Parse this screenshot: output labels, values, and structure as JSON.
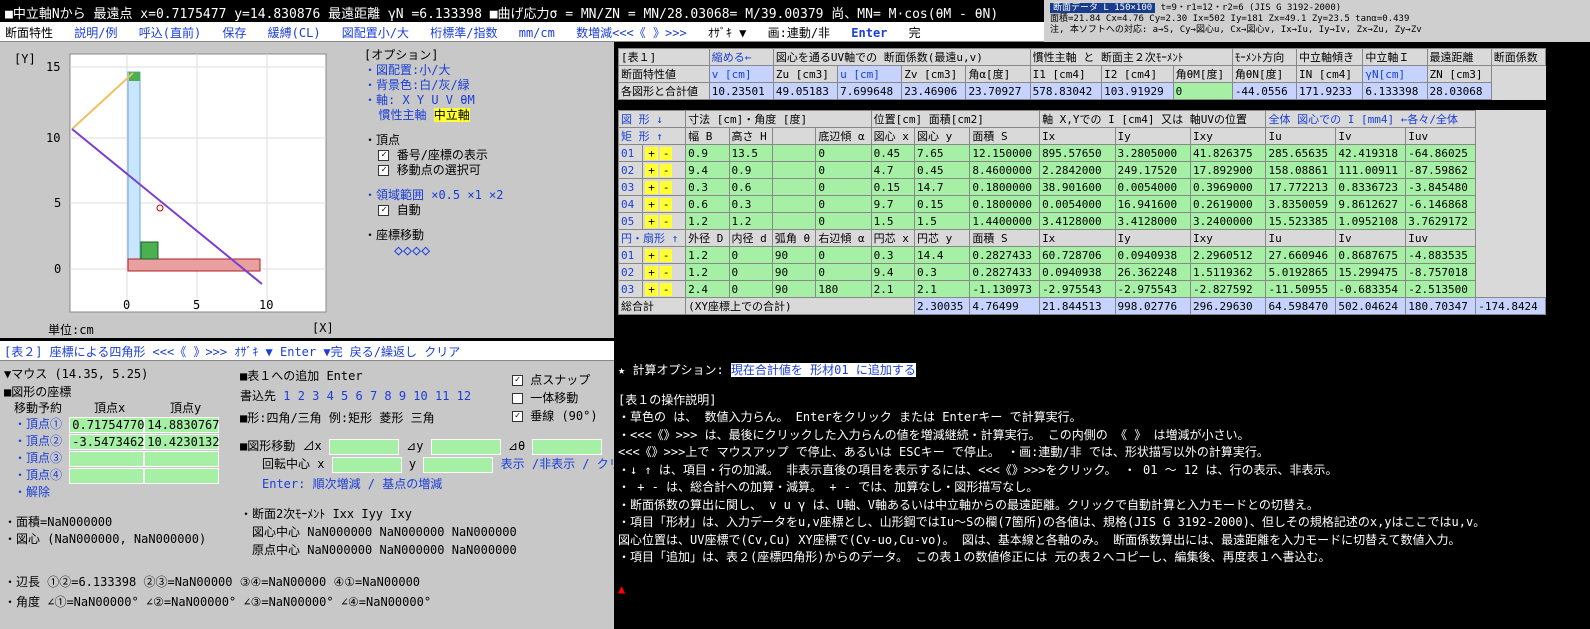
{
  "topbar": {
    "text": "■中立軸Nから 最遠点 x=0.7175477 y=14.830876 最遠距離 γN =6.133398 ■曲げ応力σ = MN/ZN = MN/28.03068= M/39.00379 尚、MN= M·cos(θM - θN)"
  },
  "info": {
    "tag": "断面データ L 150×100",
    "l1": "t=9・r1=12・r2=6 (JIS G 3192-2000)",
    "l2": "面積=21.84 Cx=4.76 Cy=2.30 Ix=502 Iy=181 Zx=49.1 Zy=23.5 tanα=0.439",
    "l3": "注, 本ソフトへの対応: a→S, Cy→図心u, Cx→図心v, Ix→Iu, Iy→Iv, Zx→Zu, Zy→Zv"
  },
  "menu": {
    "items": [
      "断面特性",
      "説明/例",
      "呼込(直前)",
      "保存",
      "緩縛(CL)",
      "図配置小/大",
      "桁標準/指数",
      "mm/cm",
      "数増減<<<《 》>>>",
      "ｵｻﾞｷ ▼",
      "画:連動/非",
      "Enter",
      "完"
    ]
  },
  "plot": {
    "y_axis_label": "[Y]",
    "x_axis_label": "[X]",
    "unit": "単位:cm",
    "y_ticks": [
      "15",
      "10",
      "5",
      "0"
    ],
    "x_ticks": [
      "0",
      "5",
      "10"
    ]
  },
  "options": {
    "title": "[オプション]",
    "l1": "・図配置:小/大",
    "l2": "・背景色:白/灰/緑",
    "l3": "・軸: X Y U V θM",
    "l4a": "慣性主軸",
    "l4b": "中立軸",
    "l5": "・頂点",
    "l6": "番号/座標の表示",
    "l7": "移動点の選択可",
    "l8": "・領域範囲 ×0.5 ×1 ×2",
    "l9": "自動",
    "l10": "・座標移動",
    "diamond": "◇◇◇◇"
  },
  "table2": {
    "hdr": "[表２] 座標による四角形  <<<《 》>>>  ｵｻﾞｷ ▼  Enter ▼完  戻る/繰返し クリア",
    "mouse": "▼マウス (14.35, 5.25)",
    "coord_title": "■図形の座標",
    "move": "移動予約",
    "col_x": "頂点x",
    "col_y": "頂点y",
    "v1": "・頂点①",
    "v1x": "0.71754770",
    "v1y": "14.8830767",
    "v2": "・頂点②",
    "v2x": "-3.5473462",
    "v2y": "10.4230132",
    "v3": "・頂点③",
    "v4": "・頂点④",
    "reset": "・解除",
    "add_title": "■表１への追加 Enter",
    "write_to": "書込先",
    "write_nums": "1 2 3 4 5 6 7 8 9 10 11 12",
    "shape": "■形:四角/三角 例:矩形 菱形 三角",
    "snap": "点スナップ",
    "move_one": "一体移動",
    "perp": "垂線 (90°)",
    "shape_move": "■図形移動 ⊿x",
    "dy": "⊿y",
    "dth": "⊿θ",
    "rot": "回転中心 x",
    "rot_y": "y",
    "showhide": "表示 /非表示 / クリア",
    "enter_row": "Enter: 順次増減 / 基点の増減",
    "area": "・面積=NaN000000",
    "centroid": "・図心 (NaN000000, NaN000000)",
    "sm_title": "・断面2次ﾓｰﾒﾝﾄ Ixx Iyy Ixy",
    "sm1": "図心中心  NaN000000  NaN000000  NaN000000",
    "sm2": "原点中心  NaN000000  NaN000000  NaN000000",
    "side": "・辺長 ①②=6.133398   ②③=NaN00000    ③④=NaN00000    ④①=NaN00000",
    "angle": "・角度 ∠①=NaN00000°    ∠②=NaN00000°    ∠③=NaN00000°    ∠④=NaN00000°"
  },
  "table1": {
    "head1": [
      "[表１]",
      "縮める←",
      "図心を通るUV軸での 断面係数(最遠u,v)",
      "慣性主軸 と 断面主２次ﾓｰﾒﾝﾄ",
      "ﾓｰﾒﾝﾄ方向",
      "中立軸傾き",
      "中立軸Ｉ",
      "最遠距離",
      "断面係数"
    ],
    "head2": [
      "断面特性値",
      "v [cm]",
      "Zu [cm3]",
      "u [cm]",
      "Zv [cm3]",
      "角α[度]",
      "I1 [cm4]",
      "I2 [cm4]",
      "角θM[度]",
      "角θN[度]",
      "IN [cm4]",
      "γN[cm]",
      "ZN [cm3]"
    ],
    "vals": [
      "各図形と合計値",
      "10.23501",
      "49.05183",
      "7.699648",
      "23.46906",
      "23.70927",
      "578.83042",
      "103.91929",
      "0",
      "-44.0556",
      "171.9233",
      "6.133398",
      "28.03068"
    ],
    "rect_head": [
      "図 形 ↓",
      "寸法 [cm]・角度 [度]",
      "位置[cm] 面積[cm2]",
      "軸 X,Yでの I [cm4] 又は 軸UVの位置",
      "全体 図心での I [mm4] ←各々/全体"
    ],
    "rect_cols": [
      "矩 形 ↑",
      "幅 B",
      "高さ H",
      "",
      "底辺傾 α",
      "図心 x",
      "図心 y",
      "面積 S",
      "Ix",
      "Iy",
      "Ixy",
      "Iu",
      "Iv",
      "Iuv"
    ],
    "rect_rows": [
      [
        "01",
        "0.9",
        "13.5",
        "",
        "0",
        "0.45",
        "7.65",
        "12.150000",
        "895.57650",
        "3.2805000",
        "41.826375",
        "285.65635",
        "42.419318",
        "-64.86025"
      ],
      [
        "02",
        "9.4",
        "0.9",
        "",
        "0",
        "4.7",
        "0.45",
        "8.4600000",
        "2.2842000",
        "249.17520",
        "17.892900",
        "158.08861",
        "111.00911",
        "-87.59862"
      ],
      [
        "03",
        "0.3",
        "0.6",
        "",
        "0",
        "0.15",
        "14.7",
        "0.1800000",
        "38.901600",
        "0.0054000",
        "0.3969000",
        "17.772213",
        "0.8336723",
        "-3.845480"
      ],
      [
        "04",
        "0.6",
        "0.3",
        "",
        "0",
        "9.7",
        "0.15",
        "0.1800000",
        "0.0054000",
        "16.941600",
        "0.2619000",
        "3.8350059",
        "9.8612627",
        "-6.146868"
      ],
      [
        "05",
        "1.2",
        "1.2",
        "",
        "0",
        "1.5",
        "1.5",
        "1.4400000",
        "3.4128000",
        "3.4128000",
        "3.2400000",
        "15.523385",
        "1.0952108",
        "3.7629172"
      ]
    ],
    "circ_cols": [
      "円・扇形 ↑",
      "外径 D",
      "内径 d",
      "弧角 θ",
      "右辺傾 α",
      "円芯 x",
      "円芯 y",
      "面積 S",
      "Ix",
      "Iy",
      "Ixy",
      "Iu",
      "Iv",
      "Iuv"
    ],
    "circ_rows": [
      [
        "01",
        "1.2",
        "0",
        "90",
        "0",
        "0.3",
        "14.4",
        "0.2827433",
        "60.728706",
        "0.0940938",
        "2.2960512",
        "27.660946",
        "0.8687675",
        "-4.883535"
      ],
      [
        "02",
        "1.2",
        "0",
        "90",
        "0",
        "9.4",
        "0.3",
        "0.2827433",
        "0.0940938",
        "26.362248",
        "1.5119362",
        "5.0192865",
        "15.299475",
        "-8.757018"
      ],
      [
        "03",
        "2.4",
        "0",
        "90",
        "180",
        "2.1",
        "2.1",
        "-1.130973",
        "-2.975543",
        "-2.975543",
        "-2.827592",
        "-11.50955",
        "-0.683354",
        "-2.513500"
      ]
    ],
    "total": [
      "総合計",
      "(XY座標上での合計)",
      "2.30035",
      "4.76499",
      "21.844513",
      "998.02776",
      "296.29630",
      "64.598470",
      "502.04624",
      "180.70347",
      "-174.8424"
    ]
  },
  "ops": {
    "opt_line": "★ 計算オプション:",
    "opt_link": "現在合計値を 形材01 に追加する",
    "title": "[表１の操作説明]",
    "lines": [
      "・草色の      は、 数値入力らん。 Enterをクリック または Enterキー で計算実行。",
      "・<<<《》>>> は、最後にクリックした入力らんの値を増減継続・計算実行。 この内側の 《 》 は増減が小さい。",
      "          <<<《》>>>上で マウスアップ で停止、あるいは ESCキー で停止。   ・画:連動/非 では、形状描写以外の計算実行。",
      "・↓ ↑ は、項目・行の加減。   非表示直後の項目を表示するには、<<<《》>>>をクリック。   ・ 01 ～ 12 は、行の表示、非表示。",
      "・ +  -  は、総合計への加算・減算。    + -  では、加算なし・図形描写なし。",
      "・断面係数の算出に関し、 v   u   γ は、U軸、V軸あるいは中立軸からの最遠距離。クリックで自動計算と入力モードとの切替え。",
      "・項目「形材」は、入力データをu,v座標とし、山形鋼ではIu～Sの欄(7箇所)の各値は、規格(JIS G 3192-2000)、但しその規格記述のx,yはここではu,v。",
      "  図心位置は、UV座標で(Cv,Cu) XY座標で(Cv-uo,Cu-vo)。 図は、基本線と各軸のみ。 断面係数算出には、最遠距離を入力モードに切替えて数値入力。",
      "・項目「追加」は、表２(座標四角形)からのデータ。 この表１の数値修正には 元の表２へコピーし、編集後、再度表１へ書込む。"
    ]
  }
}
